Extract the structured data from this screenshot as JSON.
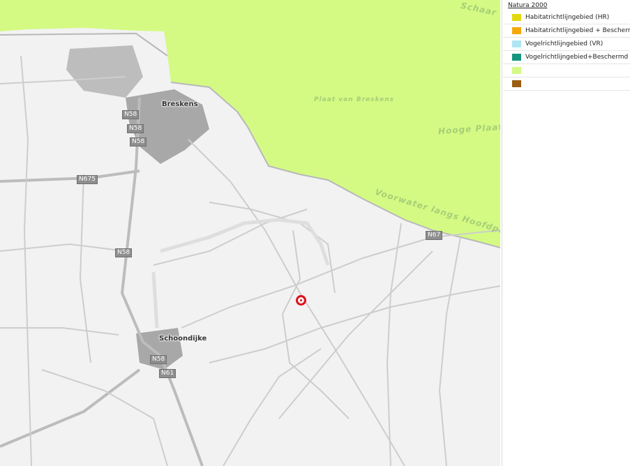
{
  "map": {
    "places": [
      {
        "name": "Breskens",
        "kind": "town"
      },
      {
        "name": "Schoondijke",
        "kind": "town"
      },
      {
        "name": "Plaat van Breskens",
        "kind": "water"
      },
      {
        "name": "Hooge Plaat",
        "kind": "water"
      },
      {
        "name": "Voorwater langs Hoofdplaat",
        "kind": "water"
      },
      {
        "name": "Schaar",
        "kind": "water"
      }
    ],
    "road_shields": [
      "N58",
      "N58",
      "N58",
      "N675",
      "N58",
      "N58",
      "N61",
      "N67"
    ],
    "marker": {
      "name": "location-marker",
      "color": "#e0101c"
    },
    "colors": {
      "land": "#f2f2f2",
      "natura_area": "#d4fa84",
      "roads": "#c9c9c9",
      "urban": "#a8a8a8"
    }
  },
  "legend": {
    "title": "Natura 2000",
    "items": [
      {
        "label": "Habitatrichtlijngebied (HR)",
        "color": "#e3d80e"
      },
      {
        "label": "Habitatrichtlijngebied + Beschermd",
        "color": "#f5a80c"
      },
      {
        "label": "Vogelrichtlijngebied (VR)",
        "color": "#aee6f4"
      },
      {
        "label": "Vogelrichtlijngebied+Beschermd",
        "color": "#16957f"
      },
      {
        "label": "",
        "color": "#d4fa84"
      },
      {
        "label": "",
        "color": "#9c5c12"
      }
    ]
  }
}
